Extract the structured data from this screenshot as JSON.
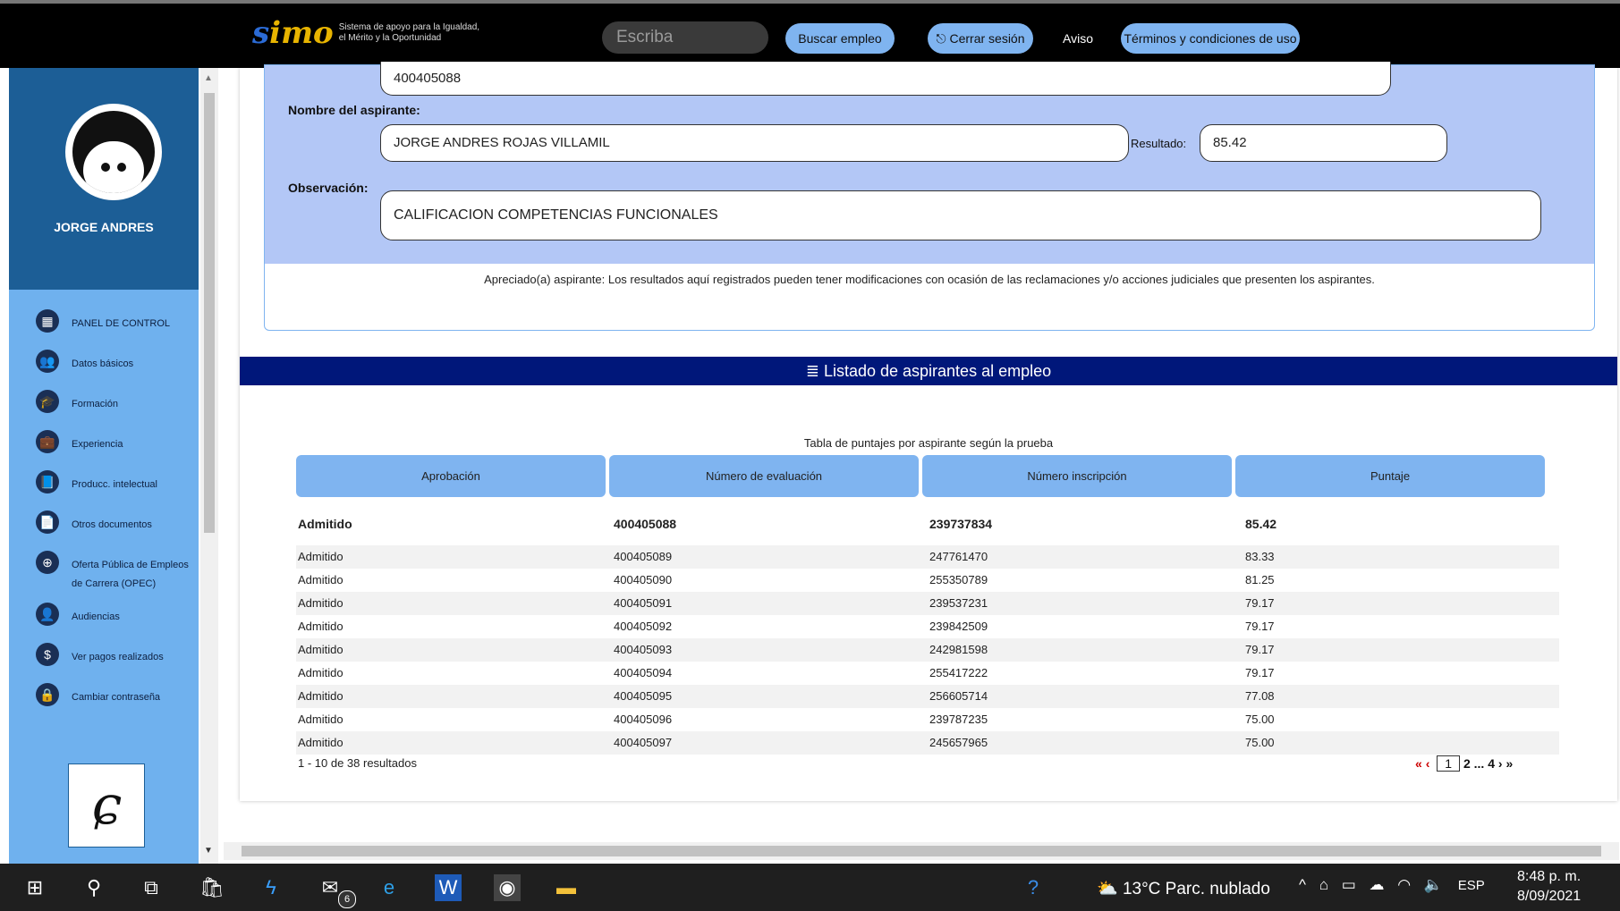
{
  "header": {
    "logo_text": "simo",
    "logo_tagline_1": "Sistema de apoyo para la Igualdad,",
    "logo_tagline_2": "el Mérito y la Oportunidad",
    "search_placeholder": "Escriba",
    "buscar_label": "Buscar empleo",
    "cerrar_label": "Cerrar sesión",
    "aviso_label": "Aviso",
    "terminos_label": "Términos y condiciones de uso"
  },
  "sidebar": {
    "user_name": "JORGE ANDRES",
    "items": [
      {
        "label": "PANEL DE CONTROL",
        "icon": "dashboard-icon",
        "glyph": "▦"
      },
      {
        "label": "Datos básicos",
        "icon": "people-icon",
        "glyph": "👥"
      },
      {
        "label": "Formación",
        "icon": "graduation-icon",
        "glyph": "🎓"
      },
      {
        "label": "Experiencia",
        "icon": "briefcase-icon",
        "glyph": "💼"
      },
      {
        "label": "Producc. intelectual",
        "icon": "book-icon",
        "glyph": "📘"
      },
      {
        "label": "Otros documentos",
        "icon": "document-icon",
        "glyph": "📄"
      },
      {
        "label": "Oferta Pública de Empleos de Carrera (OPEC)",
        "icon": "globe-icon",
        "glyph": "⊕"
      },
      {
        "label": "Audiencias",
        "icon": "audience-icon",
        "glyph": "👤"
      },
      {
        "label": "Ver pagos realizados",
        "icon": "dollar-icon",
        "glyph": "$"
      },
      {
        "label": "Cambiar contraseña",
        "icon": "lock-icon",
        "glyph": "🔒"
      }
    ]
  },
  "detail": {
    "numero_evaluacion": "400405088",
    "nombre_label": "Nombre del aspirante:",
    "nombre_value": "JORGE ANDRES ROJAS VILLAMIL",
    "resultado_label": "Resultado:",
    "resultado_value": "85.42",
    "observacion_label": "Observación:",
    "observacion_value": "CALIFICACION COMPETENCIAS FUNCIONALES",
    "notice": "Apreciado(a) aspirante: Los resultados aquí registrados pueden tener modificaciones con ocasión de las reclamaciones y/o acciones judiciales que presenten los aspirantes."
  },
  "listado": {
    "title": "Listado de aspirantes al empleo",
    "caption": "Tabla de puntajes por aspirante según la prueba",
    "columns": [
      "Aprobación",
      "Número de evaluación",
      "Número inscripción",
      "Puntaje"
    ],
    "rows": [
      [
        "Admitido",
        "400405088",
        "239737834",
        "85.42"
      ],
      [
        "Admitido",
        "400405089",
        "247761470",
        "83.33"
      ],
      [
        "Admitido",
        "400405090",
        "255350789",
        "81.25"
      ],
      [
        "Admitido",
        "400405091",
        "239537231",
        "79.17"
      ],
      [
        "Admitido",
        "400405092",
        "239842509",
        "79.17"
      ],
      [
        "Admitido",
        "400405093",
        "242981598",
        "79.17"
      ],
      [
        "Admitido",
        "400405094",
        "255417222",
        "79.17"
      ],
      [
        "Admitido",
        "400405095",
        "256605714",
        "77.08"
      ],
      [
        "Admitido",
        "400405096",
        "239787235",
        "75.00"
      ],
      [
        "Admitido",
        "400405097",
        "245657965",
        "75.00"
      ]
    ],
    "results_text": "1 - 10 de 38 resultados",
    "pager": {
      "first": "«",
      "prev": "‹",
      "current": "1",
      "next_page": "2",
      "ellipsis": "...",
      "last_page": "4",
      "next": "›",
      "last": "»"
    }
  },
  "taskbar": {
    "mail_badge": "6",
    "weather": "13°C  Parc. nublado",
    "lang": "ESP",
    "time": "8:48 p. m.",
    "date": "8/09/2021"
  }
}
